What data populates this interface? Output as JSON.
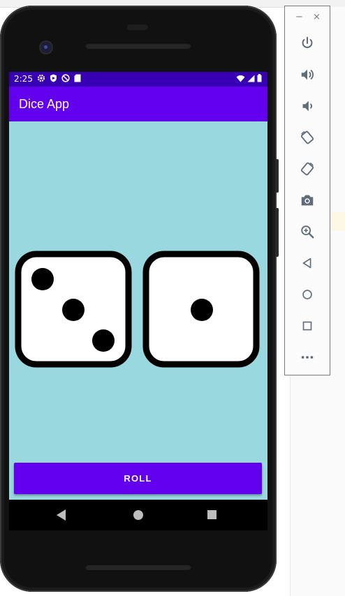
{
  "status_bar": {
    "time": "2:25",
    "left_icons": [
      "gear-icon",
      "shield-icon",
      "no-disturb-icon",
      "sd-card-icon"
    ],
    "right_icons": [
      "wifi-icon",
      "signal-icon",
      "battery-icon"
    ]
  },
  "app": {
    "title": "Dice App",
    "dice": [
      {
        "name": "die-left",
        "value": 3
      },
      {
        "name": "die-right",
        "value": 1
      }
    ],
    "roll_label": "ROLL"
  },
  "nav_bar": {
    "buttons": [
      "back",
      "home",
      "overview"
    ]
  },
  "emulator_toolbar": {
    "minimize_label": "−",
    "close_label": "×",
    "buttons": [
      "power",
      "volume-up",
      "volume-down",
      "rotate-left",
      "rotate-right",
      "screenshot",
      "zoom",
      "back",
      "home",
      "overview",
      "more"
    ]
  },
  "colors": {
    "primary": "#6200ee",
    "primary_dark": "#3700b3",
    "screen_background": "#9ad8e0"
  }
}
